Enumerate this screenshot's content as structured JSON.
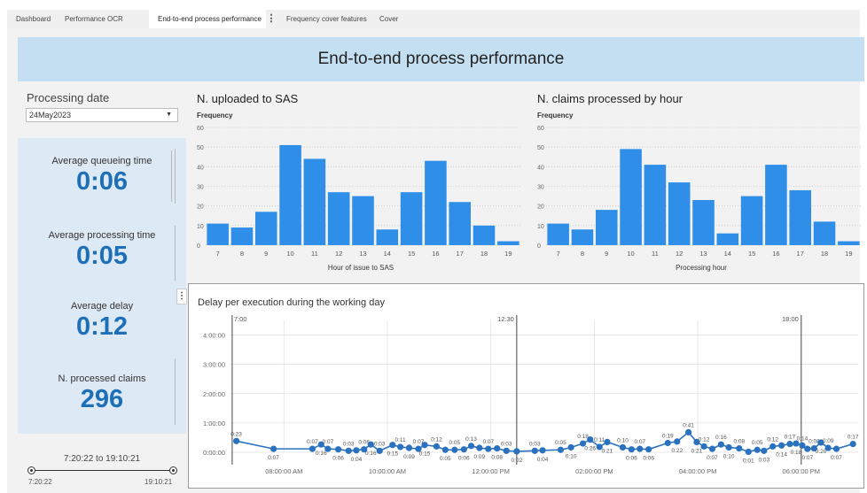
{
  "tabs": [
    {
      "label": "Dashboard"
    },
    {
      "label": "Performance OCR"
    },
    {
      "label": "End-to-end process performance",
      "active": true
    },
    {
      "label": "Frequency cover features"
    },
    {
      "label": "Cover"
    }
  ],
  "banner": {
    "title": "End-to-end process performance"
  },
  "processing": {
    "label": "Processing date",
    "value": "24May2023"
  },
  "kpis": [
    {
      "title": "Average queueing time",
      "value": "0:06"
    },
    {
      "title": "Average processing time",
      "value": "0:05"
    },
    {
      "title": "Average delay",
      "value": "0:12"
    },
    {
      "title": "N. processed claims",
      "value": "296"
    }
  ],
  "range": {
    "text": "7:20:22 to 19:10:21",
    "min": "7:20:22",
    "max": "19:10:21"
  },
  "colors": {
    "bar": "#2f8fe8",
    "kpi_value": "#1d6fb8",
    "banner": "#c5dff2",
    "line": "#2a72bf"
  },
  "chart_data": [
    {
      "type": "bar",
      "title": "N. uploaded to SAS",
      "ylabel": "Frequency",
      "xlabel": "Hour of issue to SAS",
      "categories": [
        "7",
        "8",
        "9",
        "10",
        "11",
        "12",
        "13",
        "14",
        "15",
        "16",
        "17",
        "18",
        "19"
      ],
      "values": [
        11,
        9,
        17,
        51,
        44,
        27,
        25,
        8,
        27,
        43,
        22,
        10,
        2
      ],
      "yticks": [
        0,
        10,
        20,
        30,
        40,
        50,
        60
      ],
      "ylim": [
        0,
        60
      ],
      "grid": true
    },
    {
      "type": "bar",
      "title": "N. claims processed by hour",
      "ylabel": "Frequency",
      "xlabel": "Processing hour",
      "categories": [
        "7",
        "8",
        "9",
        "10",
        "11",
        "12",
        "13",
        "14",
        "15",
        "16",
        "17",
        "18",
        "19"
      ],
      "values": [
        11,
        8,
        18,
        49,
        41,
        32,
        23,
        6,
        25,
        41,
        28,
        12,
        2
      ],
      "yticks": [
        0,
        10,
        20,
        30,
        40,
        50,
        60
      ],
      "ylim": [
        0,
        60
      ],
      "grid": true
    },
    {
      "type": "line",
      "title": "Delay per execution during the working day",
      "yticks": [
        "0:00:00",
        "1:00:00",
        "2:00:00",
        "3:00:00",
        "4:00:00"
      ],
      "xticks": [
        {
          "hour": 8,
          "label": "08:00:00 AM"
        },
        {
          "hour": 10,
          "label": "10:00:00 AM"
        },
        {
          "hour": 12,
          "label": "12:00:00 PM"
        },
        {
          "hour": 14,
          "label": "02:00:00 PM"
        },
        {
          "hour": 16,
          "label": "04:00:00 PM"
        },
        {
          "hour": 18,
          "label": "06:00:00 PM"
        }
      ],
      "reference_lines": [
        {
          "hour": 7.0,
          "label": "7:00"
        },
        {
          "hour": 12.5,
          "label": "12:30"
        },
        {
          "hour": 18.0,
          "label": "18:00"
        }
      ],
      "xlim": [
        6.95,
        19.1
      ],
      "ylim_minutes": [
        0,
        270
      ],
      "points": [
        {
          "hour": 7.08,
          "minutes": 23,
          "label": "0:23"
        },
        {
          "hour": 7.8,
          "minutes": 7,
          "label": "0:07"
        },
        {
          "hour": 8.55,
          "minutes": 7,
          "label": "0:07"
        },
        {
          "hour": 8.72,
          "minutes": 16,
          "label": "0:16"
        },
        {
          "hour": 8.85,
          "minutes": 7,
          "label": "0:07"
        },
        {
          "hour": 9.05,
          "minutes": 6,
          "label": "0:06"
        },
        {
          "hour": 9.25,
          "minutes": 3,
          "label": "0:03"
        },
        {
          "hour": 9.4,
          "minutes": 4,
          "label": "0:04"
        },
        {
          "hour": 9.55,
          "minutes": 6,
          "label": "0:06"
        },
        {
          "hour": 9.68,
          "minutes": 16,
          "label": "0:16"
        },
        {
          "hour": 9.85,
          "minutes": 3,
          "label": "0:03"
        },
        {
          "hour": 10.1,
          "minutes": 15,
          "label": "0:15"
        },
        {
          "hour": 10.25,
          "minutes": 11,
          "label": "0:11"
        },
        {
          "hour": 10.42,
          "minutes": 9,
          "label": "0:09"
        },
        {
          "hour": 10.6,
          "minutes": 7,
          "label": "0:07"
        },
        {
          "hour": 10.72,
          "minutes": 15,
          "label": "0:15"
        },
        {
          "hour": 10.95,
          "minutes": 12,
          "label": "0:12"
        },
        {
          "hour": 11.12,
          "minutes": 5,
          "label": "0:05"
        },
        {
          "hour": 11.3,
          "minutes": 5,
          "label": "0:05"
        },
        {
          "hour": 11.48,
          "minutes": 6,
          "label": "0:06"
        },
        {
          "hour": 11.62,
          "minutes": 13,
          "label": "0:13"
        },
        {
          "hour": 11.78,
          "minutes": 9,
          "label": "0:09"
        },
        {
          "hour": 11.95,
          "minutes": 7,
          "label": "0:07"
        },
        {
          "hour": 12.12,
          "minutes": 8,
          "label": "0:08"
        },
        {
          "hour": 12.3,
          "minutes": 3,
          "label": "0:03"
        },
        {
          "hour": 12.5,
          "minutes": 2,
          "label": "0:02"
        },
        {
          "hour": 12.85,
          "minutes": 3,
          "label": "0:03"
        },
        {
          "hour": 13.0,
          "minutes": 4,
          "label": "0:04"
        },
        {
          "hour": 13.35,
          "minutes": 5,
          "label": "0:05"
        },
        {
          "hour": 13.55,
          "minutes": 10,
          "label": "0:10"
        },
        {
          "hour": 13.78,
          "minutes": 18,
          "label": "0:18"
        },
        {
          "hour": 13.92,
          "minutes": 26,
          "label": "0:26"
        },
        {
          "hour": 14.1,
          "minutes": 11,
          "label": "0:11"
        },
        {
          "hour": 14.25,
          "minutes": 21,
          "label": "0:21"
        },
        {
          "hour": 14.55,
          "minutes": 10,
          "label": "0:10"
        },
        {
          "hour": 14.72,
          "minutes": 6,
          "label": "0:06"
        },
        {
          "hour": 14.88,
          "minutes": 7,
          "label": "0:07"
        },
        {
          "hour": 15.05,
          "minutes": 6,
          "label": "0:06"
        },
        {
          "hour": 15.42,
          "minutes": 19,
          "label": "0:19"
        },
        {
          "hour": 15.6,
          "minutes": 22,
          "label": "0:22"
        },
        {
          "hour": 15.82,
          "minutes": 41,
          "label": "0:41"
        },
        {
          "hour": 15.98,
          "minutes": 21,
          "label": "0:21"
        },
        {
          "hour": 16.12,
          "minutes": 12,
          "label": "0:12"
        },
        {
          "hour": 16.28,
          "minutes": 7,
          "label": "0:07"
        },
        {
          "hour": 16.45,
          "minutes": 16,
          "label": "0:16"
        },
        {
          "hour": 16.6,
          "minutes": 10,
          "label": "0:10"
        },
        {
          "hour": 16.8,
          "minutes": 8,
          "label": "0:08"
        },
        {
          "hour": 16.98,
          "minutes": 1,
          "label": "0:01"
        },
        {
          "hour": 17.15,
          "minutes": 5,
          "label": "0:05"
        },
        {
          "hour": 17.28,
          "minutes": 3,
          "label": "0:03"
        },
        {
          "hour": 17.45,
          "minutes": 12,
          "label": "0:12"
        },
        {
          "hour": 17.62,
          "minutes": 14,
          "label": "0:14"
        },
        {
          "hour": 17.78,
          "minutes": 17,
          "label": "0:17"
        },
        {
          "hour": 17.9,
          "minutes": 18,
          "label": "0:18"
        },
        {
          "hour": 18.02,
          "minutes": 14,
          "label": "0:14"
        },
        {
          "hour": 18.12,
          "minutes": 7,
          "label": "0:07"
        },
        {
          "hour": 18.25,
          "minutes": 8,
          "label": "0:08"
        },
        {
          "hour": 18.38,
          "minutes": 20,
          "label": "0:20"
        },
        {
          "hour": 18.52,
          "minutes": 9,
          "label": "0:09"
        },
        {
          "hour": 18.68,
          "minutes": 7,
          "label": "0:07"
        },
        {
          "hour": 19.0,
          "minutes": 17,
          "label": "0:17"
        }
      ]
    }
  ]
}
